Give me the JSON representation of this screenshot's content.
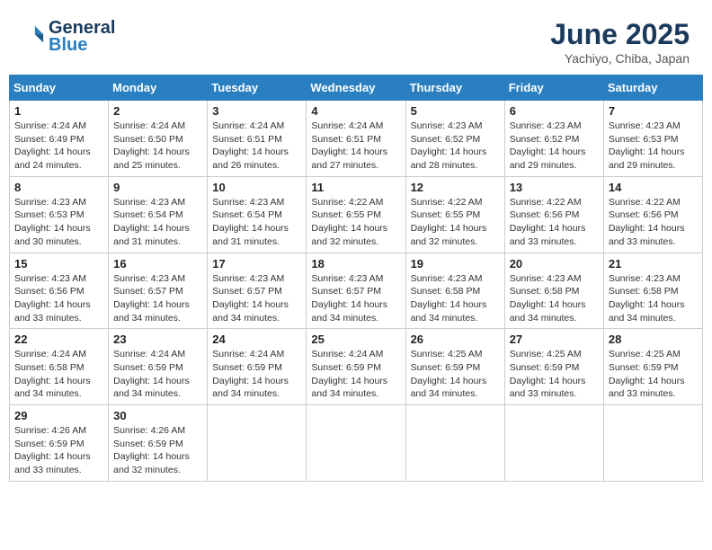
{
  "header": {
    "logo_line1": "General",
    "logo_line2": "Blue",
    "month_year": "June 2025",
    "location": "Yachiyo, Chiba, Japan"
  },
  "days_of_week": [
    "Sunday",
    "Monday",
    "Tuesday",
    "Wednesday",
    "Thursday",
    "Friday",
    "Saturday"
  ],
  "weeks": [
    [
      {
        "day": 1,
        "info": "Sunrise: 4:24 AM\nSunset: 6:49 PM\nDaylight: 14 hours\nand 24 minutes."
      },
      {
        "day": 2,
        "info": "Sunrise: 4:24 AM\nSunset: 6:50 PM\nDaylight: 14 hours\nand 25 minutes."
      },
      {
        "day": 3,
        "info": "Sunrise: 4:24 AM\nSunset: 6:51 PM\nDaylight: 14 hours\nand 26 minutes."
      },
      {
        "day": 4,
        "info": "Sunrise: 4:24 AM\nSunset: 6:51 PM\nDaylight: 14 hours\nand 27 minutes."
      },
      {
        "day": 5,
        "info": "Sunrise: 4:23 AM\nSunset: 6:52 PM\nDaylight: 14 hours\nand 28 minutes."
      },
      {
        "day": 6,
        "info": "Sunrise: 4:23 AM\nSunset: 6:52 PM\nDaylight: 14 hours\nand 29 minutes."
      },
      {
        "day": 7,
        "info": "Sunrise: 4:23 AM\nSunset: 6:53 PM\nDaylight: 14 hours\nand 29 minutes."
      }
    ],
    [
      {
        "day": 8,
        "info": "Sunrise: 4:23 AM\nSunset: 6:53 PM\nDaylight: 14 hours\nand 30 minutes."
      },
      {
        "day": 9,
        "info": "Sunrise: 4:23 AM\nSunset: 6:54 PM\nDaylight: 14 hours\nand 31 minutes."
      },
      {
        "day": 10,
        "info": "Sunrise: 4:23 AM\nSunset: 6:54 PM\nDaylight: 14 hours\nand 31 minutes."
      },
      {
        "day": 11,
        "info": "Sunrise: 4:22 AM\nSunset: 6:55 PM\nDaylight: 14 hours\nand 32 minutes."
      },
      {
        "day": 12,
        "info": "Sunrise: 4:22 AM\nSunset: 6:55 PM\nDaylight: 14 hours\nand 32 minutes."
      },
      {
        "day": 13,
        "info": "Sunrise: 4:22 AM\nSunset: 6:56 PM\nDaylight: 14 hours\nand 33 minutes."
      },
      {
        "day": 14,
        "info": "Sunrise: 4:22 AM\nSunset: 6:56 PM\nDaylight: 14 hours\nand 33 minutes."
      }
    ],
    [
      {
        "day": 15,
        "info": "Sunrise: 4:23 AM\nSunset: 6:56 PM\nDaylight: 14 hours\nand 33 minutes."
      },
      {
        "day": 16,
        "info": "Sunrise: 4:23 AM\nSunset: 6:57 PM\nDaylight: 14 hours\nand 34 minutes."
      },
      {
        "day": 17,
        "info": "Sunrise: 4:23 AM\nSunset: 6:57 PM\nDaylight: 14 hours\nand 34 minutes."
      },
      {
        "day": 18,
        "info": "Sunrise: 4:23 AM\nSunset: 6:57 PM\nDaylight: 14 hours\nand 34 minutes."
      },
      {
        "day": 19,
        "info": "Sunrise: 4:23 AM\nSunset: 6:58 PM\nDaylight: 14 hours\nand 34 minutes."
      },
      {
        "day": 20,
        "info": "Sunrise: 4:23 AM\nSunset: 6:58 PM\nDaylight: 14 hours\nand 34 minutes."
      },
      {
        "day": 21,
        "info": "Sunrise: 4:23 AM\nSunset: 6:58 PM\nDaylight: 14 hours\nand 34 minutes."
      }
    ],
    [
      {
        "day": 22,
        "info": "Sunrise: 4:24 AM\nSunset: 6:58 PM\nDaylight: 14 hours\nand 34 minutes."
      },
      {
        "day": 23,
        "info": "Sunrise: 4:24 AM\nSunset: 6:59 PM\nDaylight: 14 hours\nand 34 minutes."
      },
      {
        "day": 24,
        "info": "Sunrise: 4:24 AM\nSunset: 6:59 PM\nDaylight: 14 hours\nand 34 minutes."
      },
      {
        "day": 25,
        "info": "Sunrise: 4:24 AM\nSunset: 6:59 PM\nDaylight: 14 hours\nand 34 minutes."
      },
      {
        "day": 26,
        "info": "Sunrise: 4:25 AM\nSunset: 6:59 PM\nDaylight: 14 hours\nand 34 minutes."
      },
      {
        "day": 27,
        "info": "Sunrise: 4:25 AM\nSunset: 6:59 PM\nDaylight: 14 hours\nand 33 minutes."
      },
      {
        "day": 28,
        "info": "Sunrise: 4:25 AM\nSunset: 6:59 PM\nDaylight: 14 hours\nand 33 minutes."
      }
    ],
    [
      {
        "day": 29,
        "info": "Sunrise: 4:26 AM\nSunset: 6:59 PM\nDaylight: 14 hours\nand 33 minutes."
      },
      {
        "day": 30,
        "info": "Sunrise: 4:26 AM\nSunset: 6:59 PM\nDaylight: 14 hours\nand 32 minutes."
      },
      null,
      null,
      null,
      null,
      null
    ]
  ]
}
